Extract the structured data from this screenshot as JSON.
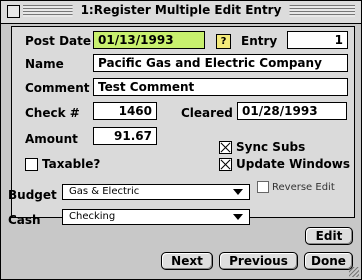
{
  "window": {
    "title": "1:Register Multiple Edit Entry"
  },
  "form": {
    "post_date_label": "Post Date",
    "post_date": "01/13/1993",
    "help_label": "?",
    "entry_label": "Entry",
    "entry_value": "1",
    "name_label": "Name",
    "name_value": "Pacific Gas and Electric Company",
    "comment_label": "Comment",
    "comment_value": "Test Comment",
    "check_label": "Check #",
    "check_value": "1460",
    "cleared_label": "Cleared",
    "cleared_value": "01/28/1993",
    "amount_label": "Amount",
    "amount_value": "91.67",
    "taxable_label": "Taxable?",
    "sync_subs_label": "Sync Subs",
    "update_windows_label": "Update Windows",
    "taxable_checked": false,
    "sync_subs_checked": true,
    "update_windows_checked": true
  },
  "budget": {
    "label": "Budget",
    "value": "Gas & Electric",
    "reverse_edit_label": "Reverse Edit"
  },
  "cash": {
    "label": "Cash",
    "value": "Checking"
  },
  "buttons": {
    "edit": "Edit",
    "next": "Next",
    "previous": "Previous",
    "done": "Done"
  },
  "colors": {
    "highlight": "#c8f06e",
    "background": "#c8c8c8"
  }
}
